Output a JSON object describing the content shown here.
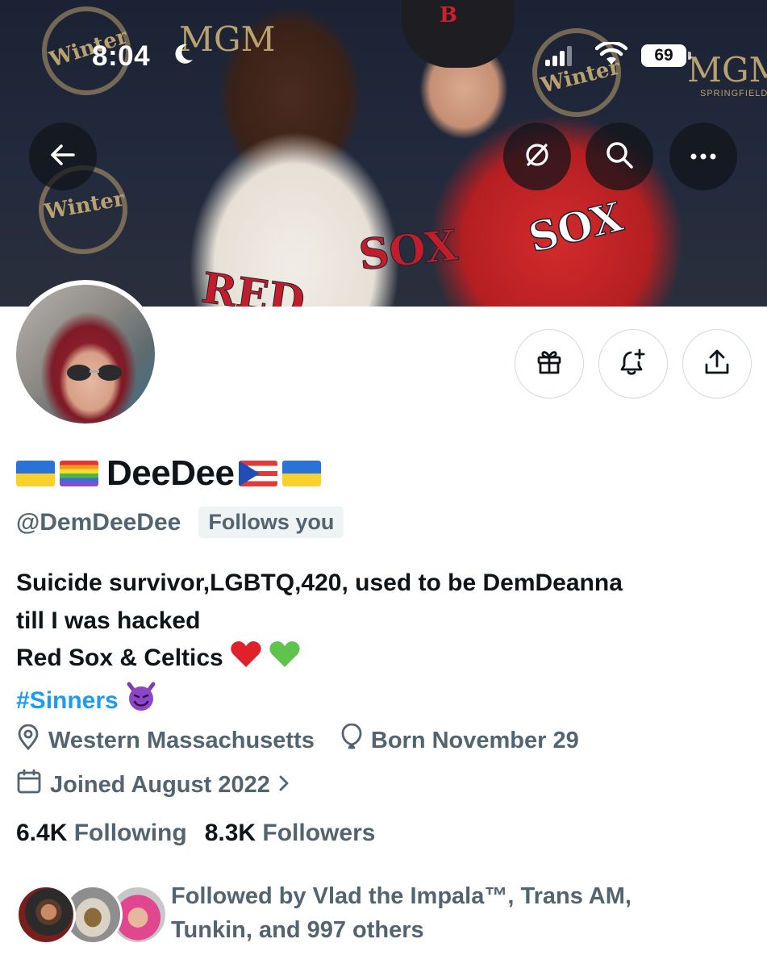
{
  "status_bar": {
    "time": "8:04",
    "battery": "69"
  },
  "banner": {
    "poster_text": "Winter",
    "poster_brand": "MGM",
    "poster_sub": "SPRINGFIELD",
    "jersey_left": "RED",
    "jersey_mid": "SOX",
    "jersey_right": "SOX",
    "cap_letter": "B"
  },
  "icons": {
    "back": "back-arrow-icon",
    "grok": "grok-icon",
    "search": "search-icon",
    "more": "more-icon",
    "gift": "gift-icon",
    "notify": "bell-plus-icon",
    "share": "share-icon",
    "location": "location-pin-icon",
    "birthday": "balloon-icon",
    "calendar": "calendar-icon",
    "moon": "moon-icon"
  },
  "profile": {
    "name": "DeeDee",
    "handle": "@DemDeeDee",
    "follows_you": "Follows you",
    "bio_line1": "Suicide survivor,LGBTQ,420, used to be DemDeanna",
    "bio_line2": "till I was hacked",
    "bio_line3": "Red Sox & Celtics",
    "hashtag": "#Sinners",
    "location": "Western Massachusetts",
    "born": "Born November 29",
    "joined": "Joined August 2022",
    "following_count": "6.4K",
    "following_label": "Following",
    "followers_count": "8.3K",
    "followers_label": "Followers",
    "followed_by_line1": "Followed by Vlad the Impala™, Trans AM,",
    "followed_by_line2": "Tunkin, and 997 others"
  },
  "colors": {
    "link": "#1d9bf0",
    "secondary_text": "#536471",
    "primary_text": "#0f1419",
    "border": "#cfd9de"
  }
}
